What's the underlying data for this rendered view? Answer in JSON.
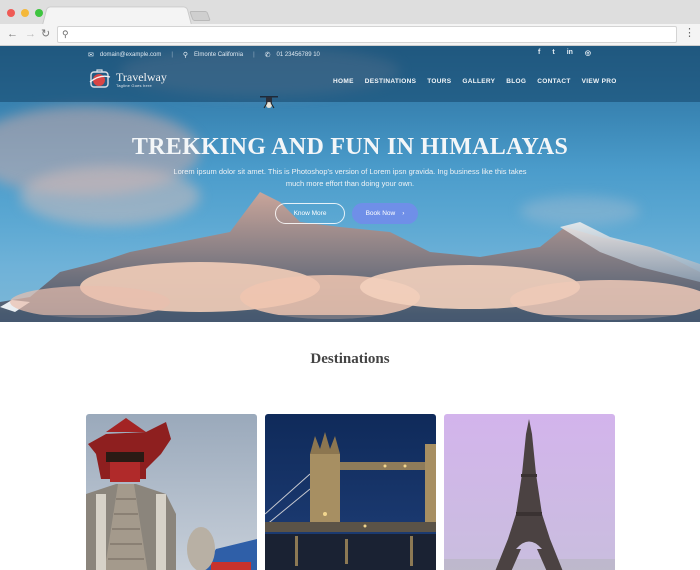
{
  "browser": {
    "tab_title": "",
    "address": "",
    "window_controls": [
      "close",
      "minimize",
      "maximize"
    ],
    "icons": {
      "back": "arrow-left-icon",
      "forward": "arrow-right-icon",
      "reload": "reload-icon",
      "search": "search-icon",
      "menu": "kebab-menu-icon"
    }
  },
  "topbar": {
    "email": "domain@example.com",
    "location": "Elmonte California",
    "phone": "01 23456789 10",
    "social": [
      {
        "name": "facebook",
        "glyph": "f"
      },
      {
        "name": "twitter",
        "glyph": "t"
      },
      {
        "name": "linkedin",
        "glyph": "in"
      },
      {
        "name": "instagram",
        "glyph": "◎"
      }
    ]
  },
  "logo": {
    "title": "Travelway",
    "tagline": "Tagline Goes here"
  },
  "nav": [
    "HOME",
    "DESTINATIONS",
    "TOURS",
    "GALLERY",
    "BLOG",
    "CONTACT",
    "VIEW PRO"
  ],
  "hero": {
    "title": "TREKKING AND FUN IN HIMALAYAS",
    "subtitle": "Lorem ipsum dolor sit amet. This is Photoshop's version of Lorem ipsn gravida. Ing business like this takes much more effort than doing your own.",
    "btn_more": "Know More",
    "btn_book": "Book Now",
    "btn_book_arrow": "›"
  },
  "destinations": {
    "title": "Destinations",
    "cards": [
      {
        "name": "Chinese pagoda"
      },
      {
        "name": "Tower Bridge London"
      },
      {
        "name": "Eiffel Tower Paris"
      }
    ]
  },
  "colors": {
    "accent": "#6f8fe8",
    "header_overlay": "#144669",
    "title_text": "#444444"
  }
}
